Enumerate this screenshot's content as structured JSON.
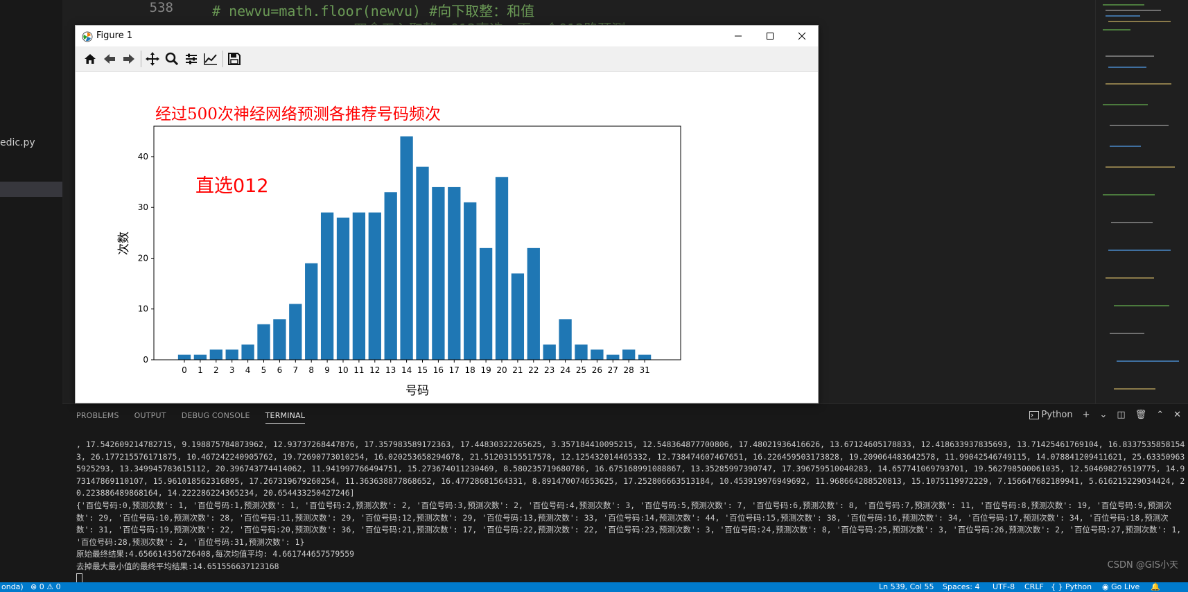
{
  "editor": {
    "line_number": "538",
    "code_line": "# newvu=math.floor(newvu) #向下取整：和值",
    "code_line_partial": "四舍五入取整，012直选，下一个012路预测"
  },
  "sidebar": {
    "file_label": "edic.py"
  },
  "figure": {
    "window_title": "Figure 1",
    "toolbar": [
      "home-icon",
      "back-icon",
      "forward-icon",
      "pan-icon",
      "zoom-icon",
      "configure-icon",
      "edit-axes-icon",
      "save-icon"
    ]
  },
  "chart_data": {
    "type": "bar",
    "title": "经过500次神经网络预测各推荐号码频次",
    "annotation": "直选012",
    "xlabel": "号码",
    "ylabel": "次数",
    "categories": [
      "0",
      "1",
      "2",
      "3",
      "4",
      "5",
      "6",
      "7",
      "8",
      "9",
      "10",
      "11",
      "12",
      "13",
      "14",
      "15",
      "16",
      "17",
      "18",
      "19",
      "20",
      "21",
      "22",
      "23",
      "24",
      "25",
      "26",
      "27",
      "28",
      "31"
    ],
    "values": [
      1,
      1,
      2,
      2,
      3,
      7,
      8,
      11,
      19,
      29,
      28,
      29,
      29,
      33,
      44,
      38,
      34,
      34,
      31,
      22,
      36,
      17,
      22,
      3,
      8,
      3,
      2,
      1,
      2,
      1
    ],
    "ylim": [
      0,
      46
    ],
    "yticks": [
      0,
      10,
      20,
      30,
      40
    ],
    "bar_color": "#1f77b4",
    "title_color": "#ff0000",
    "annotation_color": "#ff0000",
    "grid": false
  },
  "panel": {
    "tabs": [
      {
        "label": "PROBLEMS",
        "active": false
      },
      {
        "label": "OUTPUT",
        "active": false
      },
      {
        "label": "DEBUG CONSOLE",
        "active": false
      },
      {
        "label": "TERMINAL",
        "active": true
      }
    ],
    "shell_label": "Python",
    "terminal_lines": [
      ", 17.542609214782715, 9.198875784873962, 12.93737268447876, 17.357983589172363, 17.44830322265625, 3.357184410095215, 12.548364877700806, 17.48021936416626, 13.67124605178833, 12.418633937835693, 13.71425461769104, 16.83375358581543, 26.177215576171875, 10.467242240905762, 19.72690773010254, 16.020253658294678, 21.51203155517578, 12.125432014465332, 12.738474607467651, 16.226459503173828, 19.209064483642578, 11.99042546749115, 14.078841209411621, 25.633509635925293, 13.349945783615112, 20.396743774414062, 11.941997766494751, 15.273674011230469, 8.580235719680786, 16.675168991088867, 13.35285997390747, 17.396759510040283, 14.657741069793701, 19.562798500061035, 12.504698276519775, 14.973147869110107, 15.961018562316895, 17.267319679260254, 11.363638877868652, 16.47728681564331, 8.891470074653625, 17.252806663513184, 10.453919976949692, 11.968664288520813, 15.1075119972229, 7.156647682189941, 5.616215229034424, 20.223886489868164, 14.222286224365234, 20.654433250427246]",
      "{'百位号码:0,预测次数': 1, '百位号码:1,预测次数': 1, '百位号码:2,预测次数': 2, '百位号码:3,预测次数': 2, '百位号码:4,预测次数': 3, '百位号码:5,预测次数': 7, '百位号码:6,预测次数': 8, '百位号码:7,预测次数': 11, '百位号码:8,预测次数': 19, '百位号码:9,预测次数': 29, '百位号码:10,预测次数': 28, '百位号码:11,预测次数': 29, '百位号码:12,预测次数': 29, '百位号码:13,预测次数': 33, '百位号码:14,预测次数': 44, '百位号码:15,预测次数': 38, '百位号码:16,预测次数': 34, '百位号码:17,预测次数': 34, '百位号码:18,预测次数': 31, '百位号码:19,预测次数': 22, '百位号码:20,预测次数': 36, '百位号码:21,预测次数': 17, '百位号码:22,预测次数': 22, '百位号码:23,预测次数': 3, '百位号码:24,预测次数': 8, '百位号码:25,预测次数': 3, '百位号码:26,预测次数': 2, '百位号码:27,预测次数': 1, '百位号码:28,预测次数': 2, '百位号码:31,预测次数': 1}",
      "原始最终结果:4.656614356726408,每次均值平均: 4.661744657579559",
      "去掉最大最小值的最终平均结果:14.651556637123168"
    ],
    "watermark": "CSDN @GIS小天"
  },
  "statusbar": {
    "left_env": "onda)",
    "errors": "0",
    "warnings": "0",
    "position": "Ln 539, Col 55",
    "spaces": "Spaces: 4",
    "encoding": "UTF-8",
    "eol": "CRLF",
    "language": "Python",
    "golive": "Go Live"
  }
}
